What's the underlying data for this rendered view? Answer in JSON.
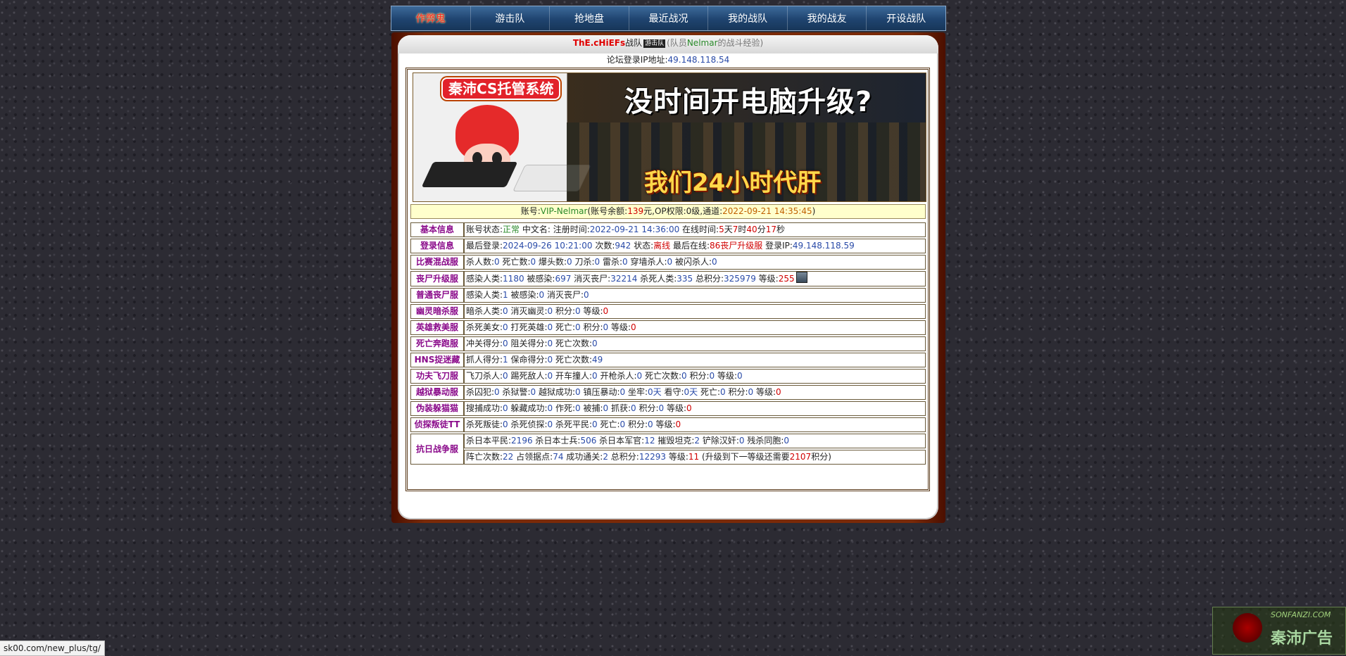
{
  "nav": [
    {
      "label": "作弊鬼",
      "active": true
    },
    {
      "label": "游击队",
      "active": false
    },
    {
      "label": "抢地盘",
      "active": false
    },
    {
      "label": "最近战况",
      "active": false
    },
    {
      "label": "我的战队",
      "active": false
    },
    {
      "label": "我的战友",
      "active": false
    },
    {
      "label": "开设战队",
      "active": false
    }
  ],
  "header": {
    "team_name": "ThE.cHiEFs",
    "team_suffix": "战队",
    "team_tag": "游击队",
    "open_paren": "(队员",
    "member": "Nelmar",
    "close_text": "的战斗经验)",
    "ip_label": "论坛登录IP地址:",
    "ip": "49.148.118.54"
  },
  "banner": {
    "logo": "秦沛CS托管系统",
    "headline": "没时间开电脑升级?",
    "subline": "我们24小时代肝"
  },
  "account": {
    "label": "账号:",
    "vip": "VIP-Nelmar",
    "balance_label": "(账号余额:",
    "balance": "139",
    "balance_unit": "元,",
    "op_text": "OP权限:0级,通道:",
    "time": "2022-09-21 14:35:45",
    "close": ")"
  },
  "rows": [
    {
      "label": "基本信息",
      "segments": [
        {
          "t": "账号状态:"
        },
        {
          "t": "正常",
          "c": "g"
        },
        {
          "t": " 中文名:  注册时间:"
        },
        {
          "t": "2022-09-21 14:36:00",
          "c": "b"
        },
        {
          "t": " 在线时间:"
        },
        {
          "t": "5",
          "c": "r"
        },
        {
          "t": "天"
        },
        {
          "t": "7",
          "c": "r"
        },
        {
          "t": "时"
        },
        {
          "t": "40",
          "c": "r"
        },
        {
          "t": "分"
        },
        {
          "t": "17",
          "c": "r"
        },
        {
          "t": "秒"
        }
      ]
    },
    {
      "label": "登录信息",
      "segments": [
        {
          "t": "最后登录:"
        },
        {
          "t": "2024-09-26 10:21:00",
          "c": "b"
        },
        {
          "t": " 次数:"
        },
        {
          "t": "942",
          "c": "b"
        },
        {
          "t": " 状态:"
        },
        {
          "t": "离线",
          "c": "r"
        },
        {
          "t": " 最后在线:"
        },
        {
          "t": "86丧尸升级服",
          "c": "r"
        },
        {
          "t": " 登录IP:"
        },
        {
          "t": "49.148.118.59",
          "c": "b"
        }
      ]
    },
    {
      "label": "比赛混战服",
      "segments": [
        {
          "t": "杀人数:"
        },
        {
          "t": "0",
          "c": "b"
        },
        {
          "t": " 死亡数:"
        },
        {
          "t": "0",
          "c": "b"
        },
        {
          "t": " 爆头数:"
        },
        {
          "t": "0",
          "c": "b"
        },
        {
          "t": " 刀杀:"
        },
        {
          "t": "0",
          "c": "b"
        },
        {
          "t": " 雷杀:"
        },
        {
          "t": "0",
          "c": "b"
        },
        {
          "t": " 穿墙杀人:"
        },
        {
          "t": "0",
          "c": "b"
        },
        {
          "t": " 被闪杀人:"
        },
        {
          "t": "0",
          "c": "b"
        }
      ]
    },
    {
      "label": "丧尸升级服",
      "rank_icon": "rank-icon",
      "segments": [
        {
          "t": "感染人类:"
        },
        {
          "t": "1180",
          "c": "b"
        },
        {
          "t": " 被感染:"
        },
        {
          "t": "697",
          "c": "b"
        },
        {
          "t": " 消灭丧尸:"
        },
        {
          "t": "32214",
          "c": "b"
        },
        {
          "t": " 杀死人类:"
        },
        {
          "t": "335",
          "c": "b"
        },
        {
          "t": " 总积分:"
        },
        {
          "t": "325979",
          "c": "b"
        },
        {
          "t": " 等级:"
        },
        {
          "t": "255",
          "c": "r"
        }
      ]
    },
    {
      "label": "普通丧尸服",
      "segments": [
        {
          "t": "感染人类:"
        },
        {
          "t": "1",
          "c": "b"
        },
        {
          "t": " 被感染:"
        },
        {
          "t": "0",
          "c": "b"
        },
        {
          "t": " 消灭丧尸:"
        },
        {
          "t": "0",
          "c": "b"
        }
      ]
    },
    {
      "label": "幽灵暗杀服",
      "segments": [
        {
          "t": "暗杀人类:"
        },
        {
          "t": "0",
          "c": "b"
        },
        {
          "t": " 消灭幽灵:"
        },
        {
          "t": "0",
          "c": "b"
        },
        {
          "t": " 积分:"
        },
        {
          "t": "0",
          "c": "b"
        },
        {
          "t": " 等级:"
        },
        {
          "t": "0",
          "c": "r"
        }
      ]
    },
    {
      "label": "英雄救美服",
      "segments": [
        {
          "t": "杀死美女:"
        },
        {
          "t": "0",
          "c": "b"
        },
        {
          "t": " 打死英雄:"
        },
        {
          "t": "0",
          "c": "b"
        },
        {
          "t": " 死亡:"
        },
        {
          "t": "0",
          "c": "b"
        },
        {
          "t": " 积分:"
        },
        {
          "t": "0",
          "c": "b"
        },
        {
          "t": " 等级:"
        },
        {
          "t": "0",
          "c": "r"
        }
      ]
    },
    {
      "label": "死亡奔跑服",
      "segments": [
        {
          "t": "冲关得分:"
        },
        {
          "t": "0",
          "c": "b"
        },
        {
          "t": " 阻关得分:"
        },
        {
          "t": "0",
          "c": "b"
        },
        {
          "t": " 死亡次数:"
        },
        {
          "t": "0",
          "c": "b"
        }
      ]
    },
    {
      "label": "HNS捉迷藏",
      "segments": [
        {
          "t": "抓人得分:"
        },
        {
          "t": "1",
          "c": "b"
        },
        {
          "t": " 保命得分:"
        },
        {
          "t": "0",
          "c": "b"
        },
        {
          "t": " 死亡次数:"
        },
        {
          "t": "49",
          "c": "b"
        }
      ]
    },
    {
      "label": "功夫飞刀服",
      "segments": [
        {
          "t": "飞刀杀人:"
        },
        {
          "t": "0",
          "c": "b"
        },
        {
          "t": " 踢死敌人:"
        },
        {
          "t": "0",
          "c": "b"
        },
        {
          "t": " 开车撞人:"
        },
        {
          "t": "0",
          "c": "b"
        },
        {
          "t": " 开枪杀人:"
        },
        {
          "t": "0",
          "c": "b"
        },
        {
          "t": " 死亡次数:"
        },
        {
          "t": "0",
          "c": "b"
        },
        {
          "t": " 积分:"
        },
        {
          "t": "0",
          "c": "b"
        },
        {
          "t": " 等级:"
        },
        {
          "t": "0",
          "c": "b"
        }
      ]
    },
    {
      "label": "越狱暴动服",
      "segments": [
        {
          "t": "杀囚犯:"
        },
        {
          "t": "0",
          "c": "b"
        },
        {
          "t": " 杀狱警:"
        },
        {
          "t": "0",
          "c": "b"
        },
        {
          "t": " 越狱成功:"
        },
        {
          "t": "0",
          "c": "b"
        },
        {
          "t": " 镇压暴动:"
        },
        {
          "t": "0",
          "c": "b"
        },
        {
          "t": " 坐牢:"
        },
        {
          "t": "0天",
          "c": "b"
        },
        {
          "t": " 看守:"
        },
        {
          "t": "0天",
          "c": "b"
        },
        {
          "t": " 死亡:"
        },
        {
          "t": "0",
          "c": "b"
        },
        {
          "t": " 积分:"
        },
        {
          "t": "0",
          "c": "b"
        },
        {
          "t": " 等级:"
        },
        {
          "t": "0",
          "c": "r"
        }
      ]
    },
    {
      "label": "伪装躲猫猫",
      "segments": [
        {
          "t": "搜捕成功:"
        },
        {
          "t": "0",
          "c": "b"
        },
        {
          "t": " 躲藏成功:"
        },
        {
          "t": "0",
          "c": "b"
        },
        {
          "t": " 作死:"
        },
        {
          "t": "0",
          "c": "b"
        },
        {
          "t": " 被捕:"
        },
        {
          "t": "0",
          "c": "b"
        },
        {
          "t": " 抓获:"
        },
        {
          "t": "0",
          "c": "b"
        },
        {
          "t": " 积分:"
        },
        {
          "t": "0",
          "c": "b"
        },
        {
          "t": " 等级:"
        },
        {
          "t": "0",
          "c": "r"
        }
      ]
    },
    {
      "label": "侦探叛徒TT",
      "segments": [
        {
          "t": "杀死叛徒:"
        },
        {
          "t": "0",
          "c": "b"
        },
        {
          "t": " 杀死侦探:"
        },
        {
          "t": "0",
          "c": "b"
        },
        {
          "t": " 杀死平民:"
        },
        {
          "t": "0",
          "c": "b"
        },
        {
          "t": " 死亡:"
        },
        {
          "t": "0",
          "c": "b"
        },
        {
          "t": " 积分:"
        },
        {
          "t": "0",
          "c": "b"
        },
        {
          "t": " 等级:"
        },
        {
          "t": "0",
          "c": "r"
        }
      ]
    }
  ],
  "war_row": {
    "label": "抗日战争服",
    "line1": [
      {
        "t": "杀日本平民:"
      },
      {
        "t": "2196",
        "c": "b"
      },
      {
        "t": " 杀日本士兵:"
      },
      {
        "t": "506",
        "c": "b"
      },
      {
        "t": " 杀日本军官:"
      },
      {
        "t": "12",
        "c": "b"
      },
      {
        "t": " 摧毁坦克:"
      },
      {
        "t": "2",
        "c": "b"
      },
      {
        "t": " 铲除汉奸:"
      },
      {
        "t": "0",
        "c": "b"
      },
      {
        "t": " 残杀同胞:"
      },
      {
        "t": "0",
        "c": "b"
      }
    ],
    "line2": [
      {
        "t": "阵亡次数:"
      },
      {
        "t": "22",
        "c": "b"
      },
      {
        "t": " 占领据点:"
      },
      {
        "t": "74",
        "c": "b"
      },
      {
        "t": " 成功通关:"
      },
      {
        "t": "2",
        "c": "b"
      },
      {
        "t": " 总积分:"
      },
      {
        "t": "12293",
        "c": "b"
      },
      {
        "t": " 等级:"
      },
      {
        "t": "11",
        "c": "r"
      },
      {
        "t": " (升级到下一等级还需要"
      },
      {
        "t": "2107",
        "c": "r"
      },
      {
        "t": "积分)"
      }
    ]
  },
  "statusbar": "sk00.com/new_plus/tg/",
  "watermark": {
    "top": "SONFANZI.COM",
    "main": "秦沛广告"
  }
}
